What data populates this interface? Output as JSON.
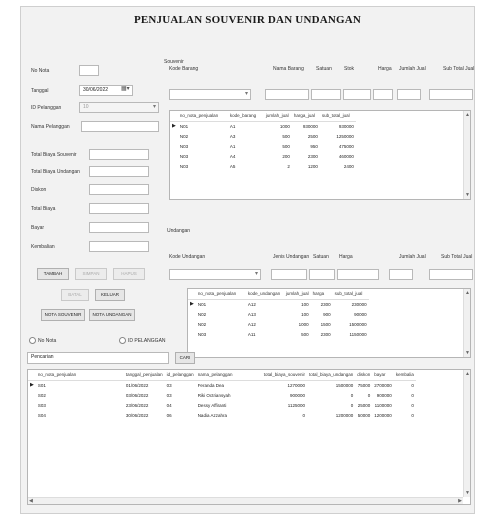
{
  "title": "PENJUALAN SOUVENIR DAN UNDANGAN",
  "left": {
    "no_nota_label": "No Nota",
    "tanggal_label": "Tanggal",
    "tanggal_value": "30/06/2022",
    "id_pelanggan_label": "ID Pelanggan",
    "id_pelanggan_value": "10",
    "nama_pelanggan_label": "Nama Pelanggan",
    "total_souvenir_label": "Total Biaya Souvenir",
    "total_undangan_label": "Total Biaya Undangan",
    "diskon_label": "Diskon",
    "total_biaya_label": "Total Biaya",
    "bayar_label": "Bayar",
    "kembalian_label": "Kembalian"
  },
  "buttons": {
    "tambah": "TAMBAH",
    "simpan": "SIMPAN",
    "hapus": "HAPUS",
    "batal": "BATAL",
    "keluar": "KELUAR",
    "nota_souvenir": "NOTA SOUVENIR",
    "nota_undangan": "NOTA UNDANGAN",
    "cari": "CARI"
  },
  "souvenir": {
    "section_label": "Souvenir",
    "kode_label": "Kode Barang",
    "nama_label": "Nama Barang",
    "satuan_label": "Satuan",
    "stok_label": "Stok",
    "harga_label": "Harga",
    "jumlah_label": "Jumlah Jual",
    "subtotal_label": "Sub Total Jual",
    "columns": [
      "no_nota_penjualan",
      "kode_barang",
      "jumlah_jual",
      "harga_jual",
      "sub_total_jual"
    ],
    "rows": [
      [
        "N01",
        "A1",
        "1000",
        "930000",
        "930000"
      ],
      [
        "N02",
        "A3",
        "500",
        "2500",
        "1250000"
      ],
      [
        "N03",
        "A1",
        "500",
        "950",
        "475000"
      ],
      [
        "N03",
        "A4",
        "200",
        "2300",
        "460000"
      ],
      [
        "N03",
        "A5",
        "2",
        "1200",
        "2400"
      ]
    ]
  },
  "undangan": {
    "section_label": "Undangan",
    "kode_label": "Kode Undangan",
    "jenis_label": "Jenis Undangan",
    "satuan_label": "Satuan",
    "harga_label": "Harga",
    "jumlah_label": "Jumlah Jual",
    "subtotal_label": "Sub Total Jual",
    "columns": [
      "no_nota_penjualan",
      "kode_undangan",
      "jumlah_jual",
      "harga",
      "sub_total_jual"
    ],
    "rows": [
      [
        "N01",
        "A12",
        "100",
        "2300",
        "230000"
      ],
      [
        "N02",
        "A13",
        "100",
        "900",
        "90000"
      ],
      [
        "N02",
        "A12",
        "1000",
        "1500",
        "1500000"
      ],
      [
        "N03",
        "A11",
        "500",
        "2300",
        "1150000"
      ]
    ]
  },
  "search": {
    "radio_nota": "No Nota",
    "radio_pelanggan": "ID PELANGGAN",
    "value": "Pencarian"
  },
  "bottom": {
    "columns": [
      "no_nota_penjualan",
      "tanggal_penjualan",
      "id_pelanggan",
      "nama_pelanggan",
      "total_biaya_souvenir",
      "total_biaya_undangan",
      "diskon",
      "bayar",
      "kembalia"
    ],
    "rows": [
      [
        "S01",
        "01/06/2022",
        "03",
        "Feranda Dea",
        "1270000",
        "1500000",
        "75000",
        "2700000",
        "0"
      ],
      [
        "S02",
        "03/06/2022",
        "03",
        "Riki Octriansyah",
        "900000",
        "0",
        "0",
        "900000",
        "0"
      ],
      [
        "S03",
        "23/06/2022",
        "04",
        "Dessy Affiranti",
        "1125000",
        "0",
        "25000",
        "1100000",
        "0"
      ],
      [
        "S04",
        "30/06/2022",
        "06",
        "Nadia Azzahra",
        "0",
        "1200000",
        "50000",
        "1200000",
        "0"
      ]
    ]
  },
  "icons": {
    "row_pointer": "▶",
    "scroll_up": "▲",
    "scroll_down": "▼",
    "scroll_left": "◀",
    "scroll_right": "▶",
    "calendar": "📅"
  }
}
